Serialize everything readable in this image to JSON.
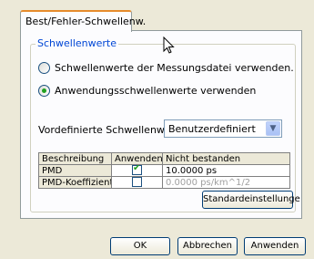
{
  "tab": {
    "label": "Best/Fehler-Schwellenw."
  },
  "group": {
    "legend": "Schwellenwerte",
    "radio_file": "Schwellenwerte der Messungsdatei verwenden.",
    "radio_app": "Anwendungsschwellenwerte verwenden",
    "radio_selected": "radio_app"
  },
  "preset": {
    "label": "Vordefinierte Schwellenwerte:",
    "value": "Benutzerdefiniert"
  },
  "table": {
    "headers": [
      "Beschreibung",
      "Anwenden",
      "Nicht bestanden"
    ],
    "rows": [
      {
        "description": "PMD",
        "apply": true,
        "value": "10.0000 ps"
      },
      {
        "description": "PMD-Koeffizient",
        "apply": false,
        "value": "0.0000 ps/km^1/2"
      }
    ]
  },
  "buttons": {
    "defaults": "Standardeinstellunge",
    "ok": "OK",
    "cancel": "Abbrechen",
    "apply": "Anwenden"
  },
  "icons": {
    "cursor": "mouse-pointer-icon",
    "dropdown": "chevron-down-icon",
    "check": "checkmark-icon"
  },
  "colors": {
    "tab_highlight": "#e68b2c",
    "legend_text": "#0046d5",
    "check_green": "#21a121"
  }
}
